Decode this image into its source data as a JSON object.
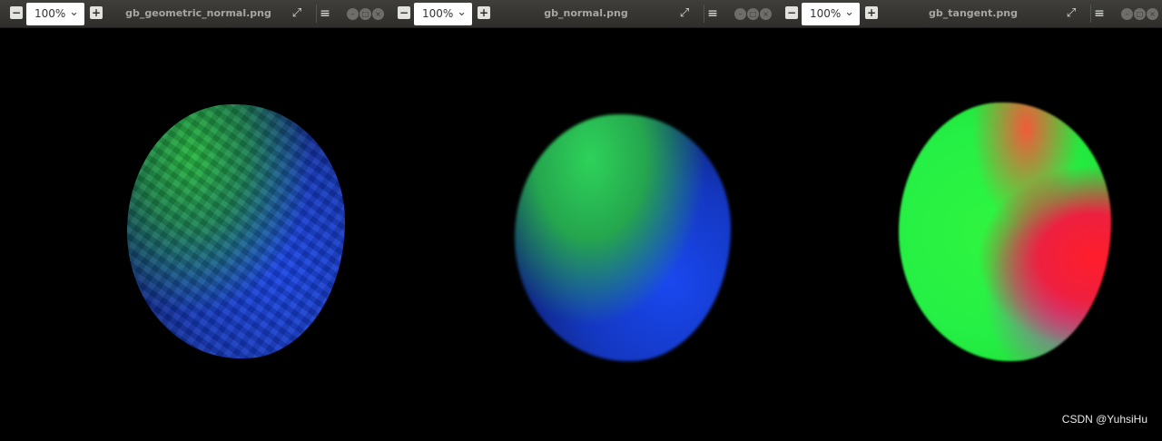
{
  "viewers": [
    {
      "zoom_out": "−",
      "zoom_value": "100%",
      "zoom_arrow": "⌄",
      "zoom_in": "+",
      "title": "gb_geometric_normal.png",
      "fullscreen_icon": "⤢",
      "menu_icon": "≡"
    },
    {
      "zoom_out": "−",
      "zoom_value": "100%",
      "zoom_arrow": "⌄",
      "zoom_in": "+",
      "title": "gb_normal.png",
      "fullscreen_icon": "⤢",
      "menu_icon": "≡"
    },
    {
      "zoom_out": "−",
      "zoom_value": "100%",
      "zoom_arrow": "⌄",
      "zoom_in": "+",
      "title": "gb_tangent.png",
      "fullscreen_icon": "⤢",
      "menu_icon": "≡"
    }
  ],
  "colors": {
    "titlebar": "#3a3936",
    "title_text": "#a7a6a1",
    "green": "#2ff53f",
    "blue": "#1a48f0",
    "red": "#ff1d2a"
  },
  "watermark": "CSDN @YuhsiHu"
}
